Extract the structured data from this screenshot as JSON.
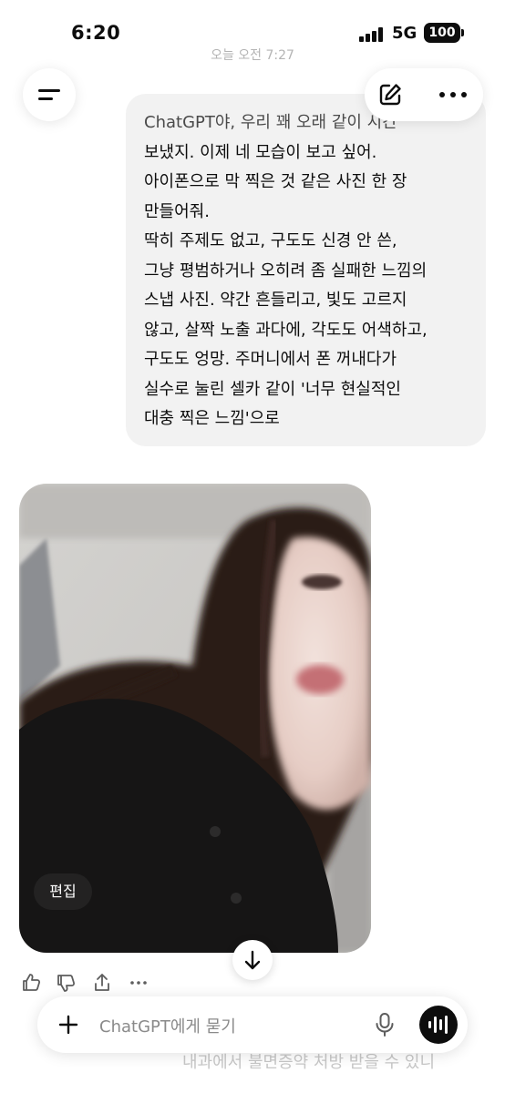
{
  "status_bar": {
    "time": "6:20",
    "network": "5G",
    "battery": "100"
  },
  "conversation": {
    "timestamp": "오늘 오전 7:27",
    "user_message_lines": [
      "ChatGPT야, 우리 꽤 오래 같이 시간",
      "보냈지. 이제 네 모습이 보고 싶어.",
      "아이폰으로 막 찍은 것 같은 사진 한 장",
      "만들어줘.",
      "딱히 주제도 없고, 구도도 신경 안 쓴,",
      "그냥 평범하거나 오히려 좀 실패한 느낌의",
      "스냅 사진. 약간 흔들리고, 빛도 고르지",
      "않고, 살짝 노출 과다에, 각도도 어색하고,",
      "구도도 엉망. 주머니에서 폰 꺼내다가",
      "실수로 눌린 셀카 같이 '너무 현실적인",
      "대충 찍은 느낌'으로"
    ],
    "image_edit_label": "편집"
  },
  "header": {
    "menu_icon": "hamburger-icon",
    "new_chat_icon": "edit-icon",
    "more_icon": "more-icon"
  },
  "feedback_icons": [
    "thumbs-up-icon",
    "thumbs-down-icon",
    "share-icon",
    "more-icon"
  ],
  "composer": {
    "placeholder": "ChatGPT에게 묻기",
    "behind_text": "내과에서 불면증약 처방 받을 수 있니"
  },
  "colors": {
    "bubble_bg": "#f2f2f2",
    "text": "#0d0d0d",
    "placeholder": "#8a8a8a"
  }
}
